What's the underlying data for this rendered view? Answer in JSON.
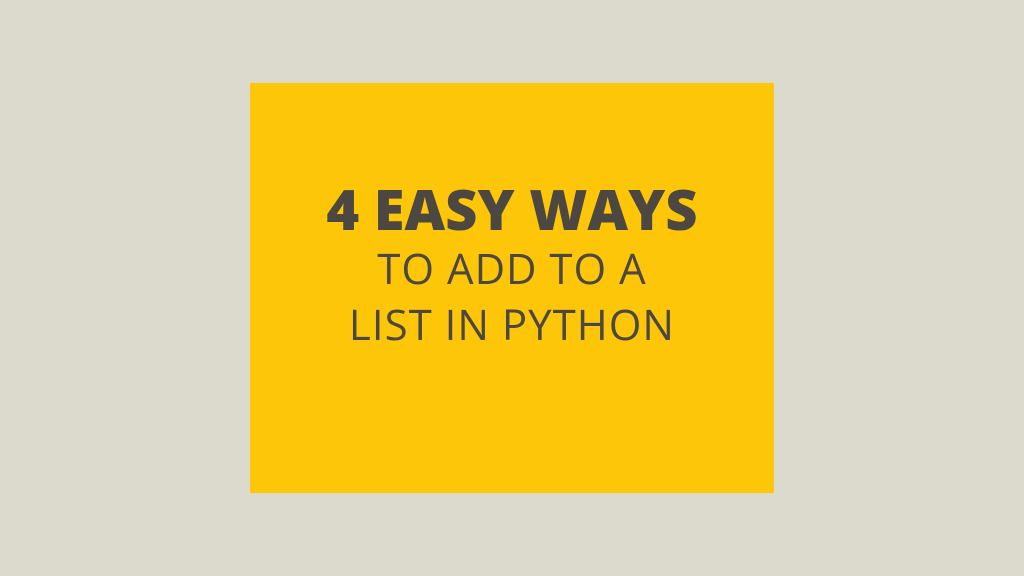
{
  "card": {
    "line1": "4 EASY WAYS",
    "line2": "TO ADD TO A",
    "line3": "LIST IN PYTHON"
  }
}
